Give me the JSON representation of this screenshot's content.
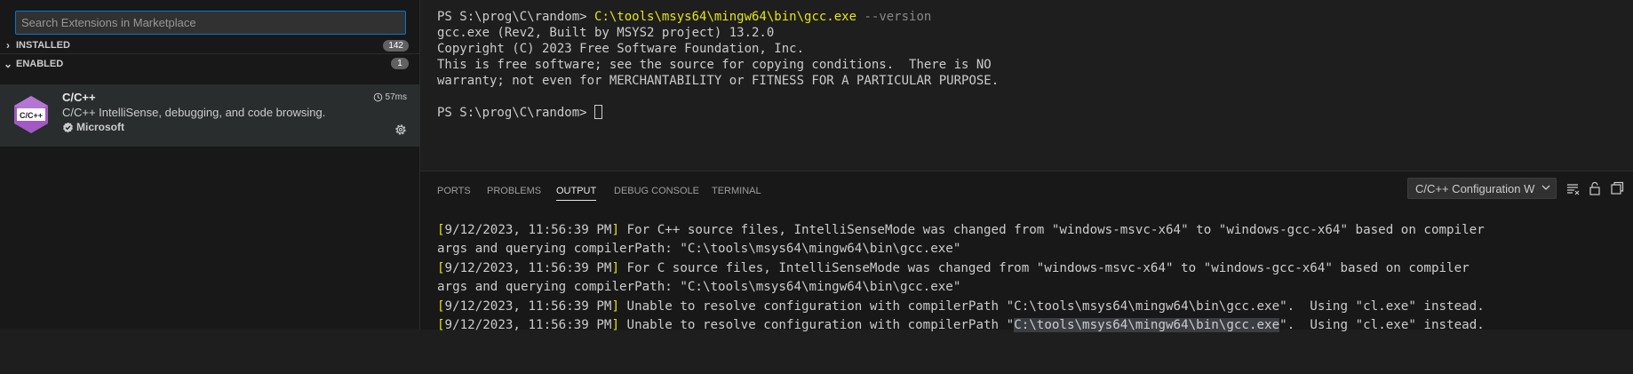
{
  "sidebar": {
    "search_placeholder": "Search Extensions in Marketplace",
    "sections": [
      {
        "label": "INSTALLED",
        "count": "142",
        "expanded": false
      },
      {
        "label": "ENABLED",
        "count": "1",
        "expanded": true
      }
    ],
    "extension": {
      "logo_text": "C/C++",
      "name": "C/C++",
      "description": "C/C++ IntelliSense, debugging, and code browsing.",
      "publisher": "Microsoft",
      "activation_time": "57ms"
    }
  },
  "terminal": {
    "prompt": "PS S:\\prog\\C\\random> ",
    "command_exe": "C:\\tools\\msys64\\mingw64\\bin\\gcc.exe",
    "command_arg": " --version",
    "output_lines": [
      "gcc.exe (Rev2, Built by MSYS2 project) 13.2.0",
      "Copyright (C) 2023 Free Software Foundation, Inc.",
      "This is free software; see the source for copying conditions.  There is NO",
      "warranty; not even for MERCHANTABILITY or FITNESS FOR A PARTICULAR PURPOSE."
    ],
    "prompt2": "PS S:\\prog\\C\\random> "
  },
  "panel": {
    "tabs": [
      {
        "label": "PORTS",
        "active": false
      },
      {
        "label": "PROBLEMS",
        "active": false
      },
      {
        "label": "OUTPUT",
        "active": true
      },
      {
        "label": "DEBUG CONSOLE",
        "active": false
      },
      {
        "label": "TERMINAL",
        "active": false
      }
    ],
    "channel": "C/C++ Configuration W",
    "output_lines": [
      {
        "ts": "9/12/2023, 11:56:39 PM",
        "text": " For C++ source files, IntelliSenseMode was changed from \"windows-msvc-x64\" to \"windows-gcc-x64\" based on compiler"
      },
      {
        "ts": "",
        "text": "args and querying compilerPath: \"C:\\tools\\msys64\\mingw64\\bin\\gcc.exe\""
      },
      {
        "ts": "9/12/2023, 11:56:39 PM",
        "text": " For C source files, IntelliSenseMode was changed from \"windows-msvc-x64\" to \"windows-gcc-x64\" based on compiler"
      },
      {
        "ts": "",
        "text": "args and querying compilerPath: \"C:\\tools\\msys64\\mingw64\\bin\\gcc.exe\""
      },
      {
        "ts": "9/12/2023, 11:56:39 PM",
        "text": " Unable to resolve configuration with compilerPath \"C:\\tools\\msys64\\mingw64\\bin\\gcc.exe\".  Using \"cl.exe\" instead."
      },
      {
        "ts": "9/12/2023, 11:56:39 PM",
        "text_pre": " Unable to resolve configuration with compilerPath \"",
        "text_hl": "C:\\tools\\msys64\\mingw64\\bin\\gcc.exe",
        "text_post": "\".  Using \"cl.exe\" instead."
      }
    ]
  },
  "colors": {
    "accent": "#0078d4",
    "terminal_yellow": "#e5e510",
    "extension_logo": "#a259c4"
  }
}
